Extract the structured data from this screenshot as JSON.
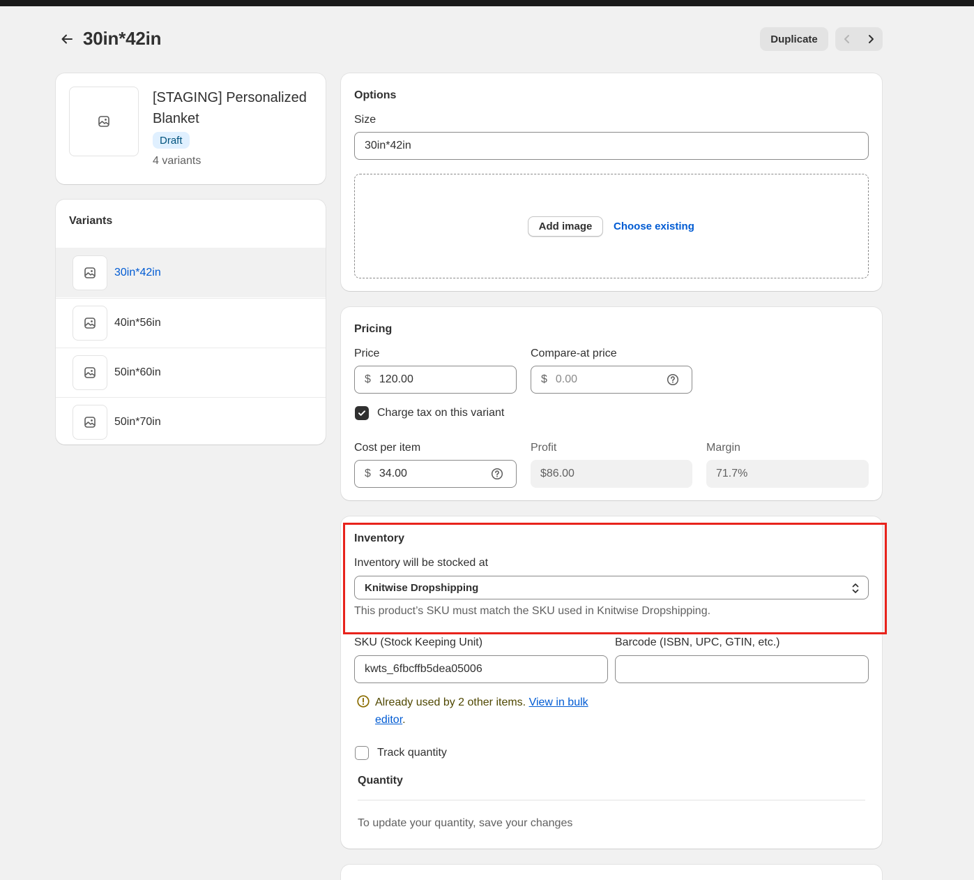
{
  "header": {
    "title": "30in*42in",
    "duplicate_label": "Duplicate"
  },
  "product": {
    "title": "[STAGING] Personalized Blanket",
    "status": "Draft",
    "variant_count": "4 variants"
  },
  "variants": {
    "title": "Variants",
    "items": [
      {
        "label": "30in*42in",
        "active": true
      },
      {
        "label": "40in*56in",
        "active": false
      },
      {
        "label": "50in*60in",
        "active": false
      },
      {
        "label": "50in*70in",
        "active": false
      }
    ]
  },
  "options": {
    "title": "Options",
    "size_label": "Size",
    "size_value": "30in*42in",
    "add_image_label": "Add image",
    "choose_existing_label": "Choose existing"
  },
  "pricing": {
    "title": "Pricing",
    "price_label": "Price",
    "currency": "$",
    "price_value": "120.00",
    "compare_label": "Compare-at price",
    "compare_placeholder": "0.00",
    "charge_tax_label": "Charge tax on this variant",
    "charge_tax_checked": true,
    "cost_label": "Cost per item",
    "cost_value": "34.00",
    "profit_label": "Profit",
    "profit_value": "$86.00",
    "margin_label": "Margin",
    "margin_value": "71.7%"
  },
  "inventory": {
    "title": "Inventory",
    "stocked_label": "Inventory will be stocked at",
    "location": "Knitwise Dropshipping",
    "help": "This product’s SKU must match the SKU used in Knitwise Dropshipping.",
    "sku_label": "SKU (Stock Keeping Unit)",
    "sku_value": "kwts_6fbcffb5dea05006",
    "barcode_label": "Barcode (ISBN, UPC, GTIN, etc.)",
    "barcode_value": "",
    "warning_text": "Already used by 2 other items.",
    "warning_link_1": "View in bulk",
    "warning_link_2": "editor",
    "warning_period": ".",
    "track_label": "Track quantity",
    "track_checked": false,
    "quantity_title": "Quantity",
    "quantity_note": "To update your quantity, save your changes"
  },
  "colors": {
    "accent": "#005bd3",
    "highlight": "#e8231c",
    "badge_bg": "#e0f0ff"
  }
}
